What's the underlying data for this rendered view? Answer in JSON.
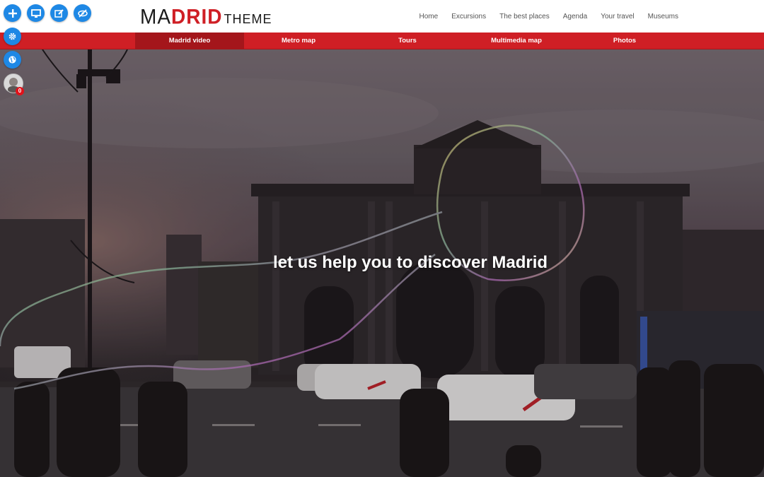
{
  "logo": {
    "part1_black": "MA",
    "part1_red": "DRID",
    "part2": "THEME"
  },
  "topnav": [
    "Home",
    "Excursions",
    "The best places",
    "Agenda",
    "Your travel",
    "Museums"
  ],
  "menubar": [
    "Madrid video",
    "Metro map",
    "Tours",
    "Multimedia map",
    "Photos"
  ],
  "hero": {
    "headline": "let us help you to discover Madrid"
  },
  "admin": {
    "buttons": [
      {
        "icon": "plus-icon"
      },
      {
        "icon": "monitor-icon"
      },
      {
        "icon": "edit-icon"
      },
      {
        "icon": "eye-slash-icon"
      },
      {
        "icon": "gear-icon"
      },
      {
        "icon": "globe-icon"
      }
    ],
    "notifications": "0"
  },
  "colors": {
    "brand_red": "#cf1f25",
    "active_menu": "#a4161b",
    "admin_blue": "#1e88e5"
  }
}
